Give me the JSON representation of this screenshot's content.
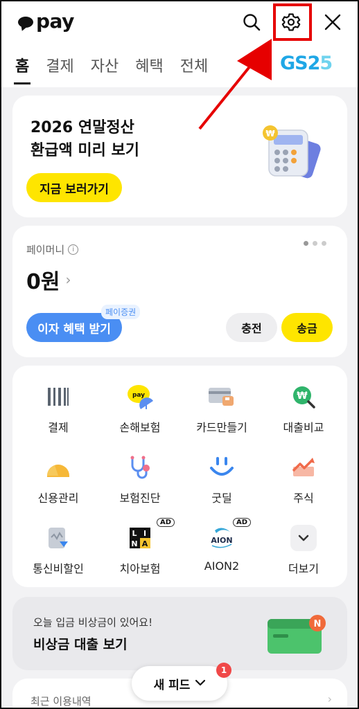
{
  "header": {
    "logo_text": "pay",
    "tabs": [
      "홈",
      "결제",
      "자산",
      "혜택",
      "전체"
    ],
    "active_tab": "홈",
    "partner_logo": "GS25"
  },
  "banner": {
    "title_line1": "2026 연말정산",
    "title_line2": "환급액 미리 보기",
    "cta": "지금 보러가기"
  },
  "money": {
    "label": "페이머니",
    "info_glyph": "i",
    "amount": "0원",
    "interest_button": "이자 혜택 받기",
    "tag": "페이증권",
    "charge_button": "충전",
    "send_button": "송금"
  },
  "menu": {
    "items": [
      {
        "label": "결제",
        "icon": "barcode-icon"
      },
      {
        "label": "손해보험",
        "icon": "umbrella-pay-icon"
      },
      {
        "label": "카드만들기",
        "icon": "card-icon"
      },
      {
        "label": "대출비교",
        "icon": "won-search-icon"
      },
      {
        "label": "신용관리",
        "icon": "gauge-icon"
      },
      {
        "label": "보험진단",
        "icon": "stethoscope-icon"
      },
      {
        "label": "굿딜",
        "icon": "smile-icon"
      },
      {
        "label": "주식",
        "icon": "stock-chart-icon"
      },
      {
        "label": "통신비할인",
        "icon": "phone-bill-icon"
      },
      {
        "label": "치아보험",
        "icon": "lina-logo"
      },
      {
        "label": "AION2",
        "icon": "aion-logo"
      },
      {
        "label": "더보기",
        "icon": "chevron-down-icon"
      }
    ],
    "ad_label": "AD",
    "lina_text": "LINA",
    "aion_text": "AION"
  },
  "loan": {
    "subtitle": "오늘 입금 비상금이 있어요!",
    "title": "비상금 대출 보기",
    "wallet_badge": "N"
  },
  "recent": {
    "label": "최근 이용내역"
  },
  "feed": {
    "label": "새 피드",
    "badge_count": "1"
  },
  "colors": {
    "kakao_yellow": "#fee500",
    "blue": "#4a8ef3",
    "highlight_red": "#e60000"
  }
}
